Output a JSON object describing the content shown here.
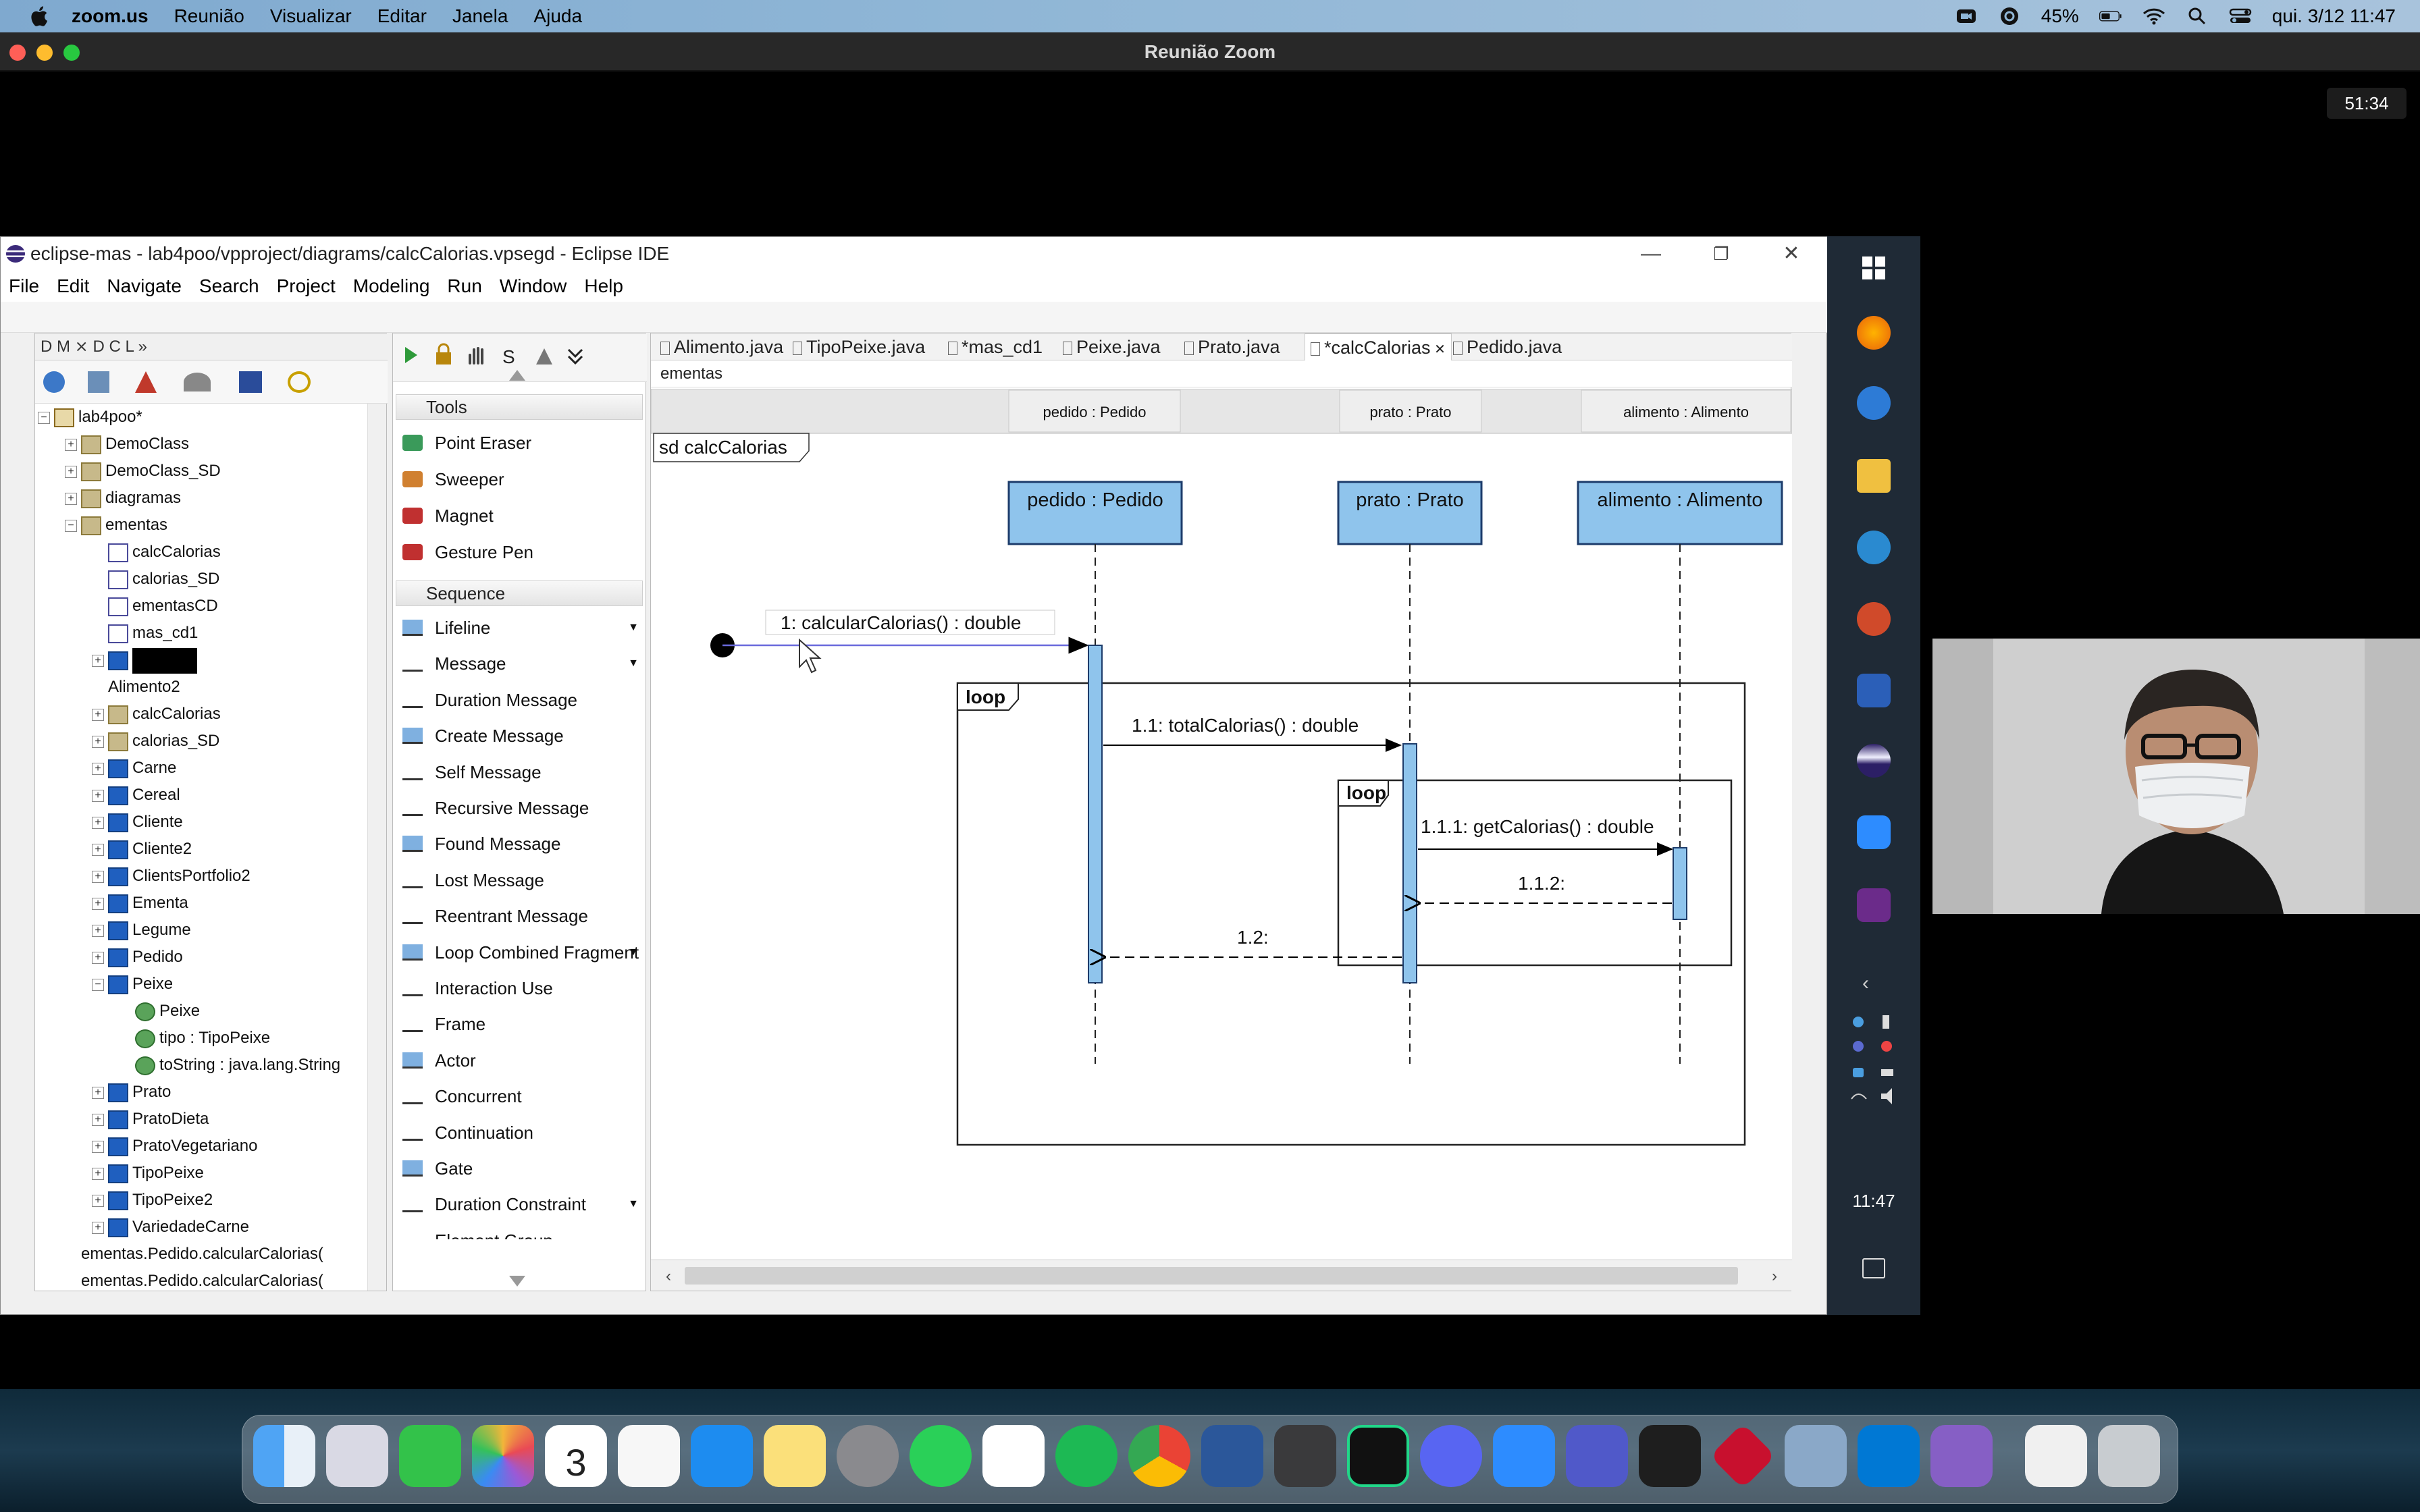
{
  "mac_menubar": {
    "app_name": "zoom.us",
    "menus": [
      "Reunião",
      "Visualizar",
      "Editar",
      "Janela",
      "Ajuda"
    ],
    "battery": "45%",
    "clock": "qui. 3/12  11:47"
  },
  "zoom": {
    "window_title": "Reunião Zoom",
    "timer": "51:34"
  },
  "eclipse": {
    "title": "eclipse-mas - lab4poo/vpproject/diagrams/calcCalorias.vpsegd - Eclipse IDE",
    "menu": [
      "File",
      "Edit",
      "Navigate",
      "Search",
      "Project",
      "Modeling",
      "Run",
      "Window",
      "Help"
    ],
    "package_explorer": {
      "tabs": "D  M  ⨯  D  C  L  »",
      "tree": [
        {
          "label": "lab4poo*",
          "icon": "project",
          "level": 0,
          "exp": "-"
        },
        {
          "label": "DemoClass",
          "icon": "package",
          "level": 1,
          "exp": "+"
        },
        {
          "label": "DemoClass_SD",
          "icon": "package",
          "level": 1,
          "exp": "+"
        },
        {
          "label": "diagramas",
          "icon": "package",
          "level": 1,
          "exp": "+"
        },
        {
          "label": "ementas",
          "icon": "package",
          "level": 1,
          "exp": "-"
        },
        {
          "label": "calcCalorias",
          "icon": "diagram",
          "level": 2,
          "exp": ""
        },
        {
          "label": "calorias_SD",
          "icon": "diagram",
          "level": 2,
          "exp": ""
        },
        {
          "label": "ementasCD",
          "icon": "diagram",
          "level": 2,
          "exp": ""
        },
        {
          "label": "mas_cd1",
          "icon": "diagram",
          "level": 2,
          "exp": ""
        },
        {
          "label": "",
          "icon": "class",
          "level": 2,
          "exp": "+",
          "redacted": true
        },
        {
          "label": "Alimento2",
          "icon": "none",
          "level": 2,
          "exp": ""
        },
        {
          "label": "calcCalorias",
          "icon": "package",
          "level": 2,
          "exp": "+"
        },
        {
          "label": "calorias_SD",
          "icon": "package",
          "level": 2,
          "exp": "+"
        },
        {
          "label": "Carne",
          "icon": "class",
          "level": 2,
          "exp": "+"
        },
        {
          "label": "Cereal",
          "icon": "class",
          "level": 2,
          "exp": "+"
        },
        {
          "label": "Cliente",
          "icon": "class",
          "level": 2,
          "exp": "+"
        },
        {
          "label": "Cliente2",
          "icon": "class",
          "level": 2,
          "exp": "+"
        },
        {
          "label": "ClientsPortfolio2",
          "icon": "class",
          "level": 2,
          "exp": "+"
        },
        {
          "label": "Ementa",
          "icon": "class",
          "level": 2,
          "exp": "+"
        },
        {
          "label": "Legume",
          "icon": "class",
          "level": 2,
          "exp": "+"
        },
        {
          "label": "Pedido",
          "icon": "class",
          "level": 2,
          "exp": "+"
        },
        {
          "label": "Peixe",
          "icon": "class",
          "level": 2,
          "exp": "-"
        },
        {
          "label": "Peixe",
          "icon": "member",
          "level": 3,
          "exp": ""
        },
        {
          "label": "tipo : TipoPeixe",
          "icon": "member",
          "level": 3,
          "exp": ""
        },
        {
          "label": "toString : java.lang.String",
          "icon": "member",
          "level": 3,
          "exp": ""
        },
        {
          "label": "Prato",
          "icon": "class",
          "level": 2,
          "exp": "+"
        },
        {
          "label": "PratoDieta",
          "icon": "class",
          "level": 2,
          "exp": "+"
        },
        {
          "label": "PratoVegetariano",
          "icon": "class",
          "level": 2,
          "exp": "+"
        },
        {
          "label": "TipoPeixe",
          "icon": "class",
          "level": 2,
          "exp": "+"
        },
        {
          "label": "TipoPeixe2",
          "icon": "class",
          "level": 2,
          "exp": "+"
        },
        {
          "label": "VariedadeCarne",
          "icon": "class",
          "level": 2,
          "exp": "+"
        },
        {
          "label": "ementas.Pedido.calcularCalorias(",
          "icon": "none",
          "level": 1,
          "exp": ""
        },
        {
          "label": "ementas.Pedido.calcularCalorias(",
          "icon": "none",
          "level": 1,
          "exp": ""
        }
      ]
    },
    "palette": {
      "tools_header": "Tools",
      "tools": [
        "Point Eraser",
        "Sweeper",
        "Magnet",
        "Gesture Pen"
      ],
      "sequence_header": "Sequence",
      "sequence_items": [
        {
          "label": "Lifeline",
          "dropdown": true
        },
        {
          "label": "Message",
          "dropdown": true
        },
        {
          "label": "Duration Message",
          "dropdown": false
        },
        {
          "label": "Create Message",
          "dropdown": false
        },
        {
          "label": "Self Message",
          "dropdown": false
        },
        {
          "label": "Recursive Message",
          "dropdown": false
        },
        {
          "label": "Found Message",
          "dropdown": false
        },
        {
          "label": "Lost Message",
          "dropdown": false
        },
        {
          "label": "Reentrant Message",
          "dropdown": false
        },
        {
          "label": "Loop Combined Fragment",
          "dropdown": true
        },
        {
          "label": "Interaction Use",
          "dropdown": false
        },
        {
          "label": "Frame",
          "dropdown": false
        },
        {
          "label": "Actor",
          "dropdown": false
        },
        {
          "label": "Concurrent",
          "dropdown": false
        },
        {
          "label": "Continuation",
          "dropdown": false
        },
        {
          "label": "Gate",
          "dropdown": false
        },
        {
          "label": "Duration Constraint",
          "dropdown": true
        },
        {
          "label": "Element Group",
          "dropdown": false
        }
      ]
    },
    "editor_tabs": [
      "Alimento.java",
      "TipoPeixe.java",
      "*mas_cd1",
      "Peixe.java",
      "Prato.java",
      "*calcCalorias",
      "Pedido.java"
    ],
    "breadcrumb": "ementas",
    "diagram": {
      "frame_label": "sd calcCalorias",
      "header_lifelines": [
        "pedido : Pedido",
        "prato : Prato",
        "alimento : Alimento"
      ],
      "lifelines": [
        "pedido : Pedido",
        "prato : Prato",
        "alimento : Alimento"
      ],
      "messages": [
        "1: calcularCalorias() : double",
        "1.1: totalCalorias() : double",
        "1.1.1: getCalorias() : double",
        "1.1.2:",
        "1.2:"
      ],
      "fragments": [
        "loop",
        "loop"
      ],
      "colors": {
        "lifeline_fill": "#8fc4ec",
        "lifeline_border": "#1d3c6b"
      }
    }
  },
  "windows_taskbar": {
    "clock": "11:47"
  }
}
